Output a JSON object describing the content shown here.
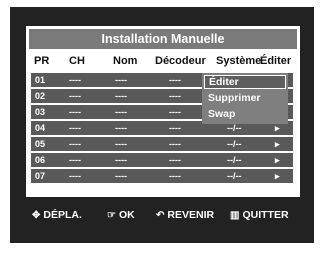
{
  "title": "Installation Manuelle",
  "headers": [
    "PR",
    "CH",
    "Nom",
    "Décodeur",
    "Système",
    "Éditer"
  ],
  "rows": [
    {
      "pr": "01",
      "ch": "----",
      "nom": "----",
      "dec": "----",
      "sys": "--/--",
      "arrow": "▸"
    },
    {
      "pr": "02",
      "ch": "----",
      "nom": "----",
      "dec": "----",
      "sys": "--/--",
      "arrow": "▸"
    },
    {
      "pr": "03",
      "ch": "----",
      "nom": "----",
      "dec": "----",
      "sys": "--/--",
      "arrow": "▸"
    },
    {
      "pr": "04",
      "ch": "----",
      "nom": "----",
      "dec": "----",
      "sys": "--/--",
      "arrow": "▸"
    },
    {
      "pr": "05",
      "ch": "----",
      "nom": "----",
      "dec": "----",
      "sys": "--/--",
      "arrow": "▸"
    },
    {
      "pr": "06",
      "ch": "----",
      "nom": "----",
      "dec": "----",
      "sys": "--/--",
      "arrow": "▸"
    },
    {
      "pr": "07",
      "ch": "----",
      "nom": "----",
      "dec": "----",
      "sys": "--/--",
      "arrow": "▸"
    }
  ],
  "popup": {
    "items": [
      "Éditer",
      "Supprimer",
      "Swap"
    ],
    "selected": "Éditer"
  },
  "footer": {
    "move_icon": "✥",
    "move_label": "DÉPLA.",
    "ok_icon": "☞",
    "ok_label": "OK",
    "back_icon": "↶",
    "back_label": "REVENIR",
    "quit_icon": "▥",
    "quit_label": "QUITTER"
  },
  "colors": {
    "background": "#222222",
    "panel": "#ffffff",
    "row": "#5a5a5a",
    "title_bar": "#7a7a7a",
    "popup": "#7f7f7f"
  }
}
